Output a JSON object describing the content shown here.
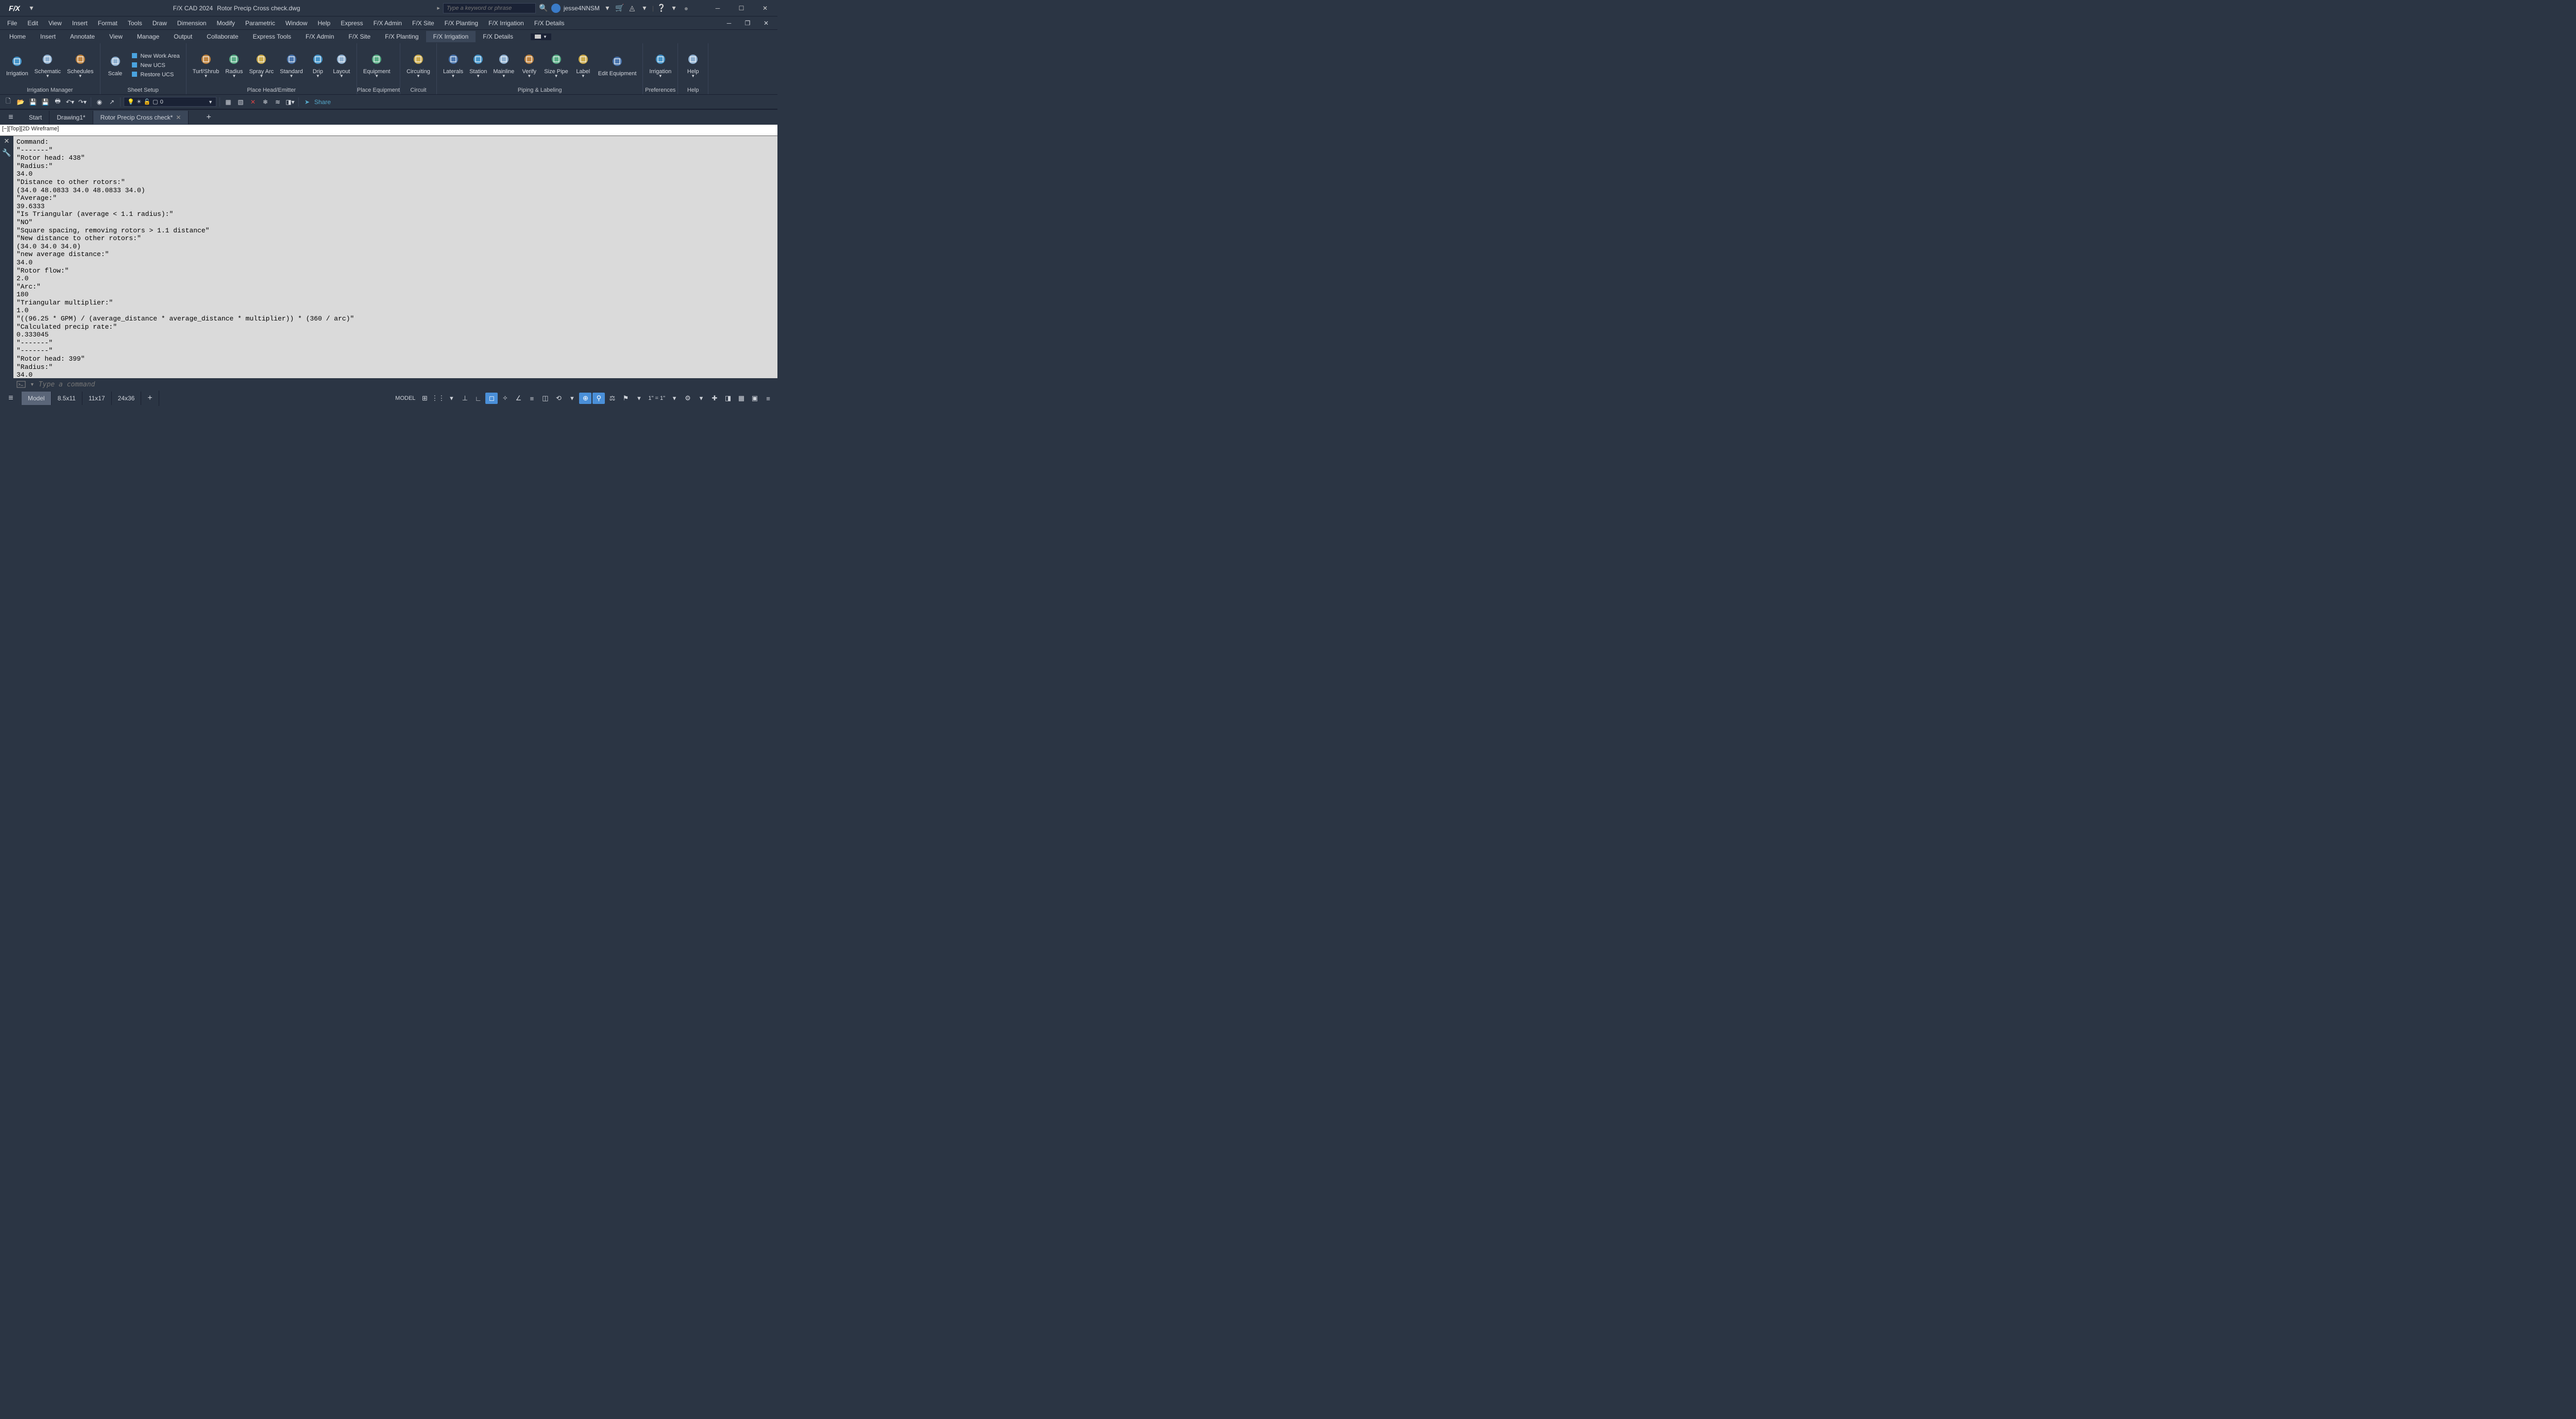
{
  "titlebar": {
    "logo": "F/X",
    "app": "F/X CAD 2024",
    "doc": "Rotor Precip Cross check.dwg",
    "search_placeholder": "Type a keyword or phrase",
    "username": "jesse4NNSM"
  },
  "menubar": [
    "File",
    "Edit",
    "View",
    "Insert",
    "Format",
    "Tools",
    "Draw",
    "Dimension",
    "Modify",
    "Parametric",
    "Window",
    "Help",
    "Express",
    "F/X Admin",
    "F/X Site",
    "F/X Planting",
    "F/X Irrigation",
    "F/X Details"
  ],
  "tabs": [
    "Home",
    "Insert",
    "Annotate",
    "View",
    "Manage",
    "Output",
    "Collaborate",
    "Express Tools",
    "F/X Admin",
    "F/X Site",
    "F/X Planting",
    "F/X Irrigation",
    "F/X Details"
  ],
  "active_tab": "F/X Irrigation",
  "ribbon": {
    "panels": [
      {
        "label": "Irrigation Manager",
        "items": [
          {
            "l": "Irrigation"
          },
          {
            "l": "Schematic",
            "dd": true
          },
          {
            "l": "Schedules",
            "dd": true
          }
        ]
      },
      {
        "label": "Sheet Setup",
        "items": [
          {
            "l": "Scale"
          }
        ],
        "col": [
          {
            "l": "New Work Area"
          },
          {
            "l": "New UCS"
          },
          {
            "l": "Restore UCS"
          }
        ]
      },
      {
        "label": "Place Head/Emitter",
        "items": [
          {
            "l": "Turf/Shrub",
            "dd": true
          },
          {
            "l": "Radius",
            "dd": true
          },
          {
            "l": "Spray Arc",
            "dd": true
          },
          {
            "l": "Standard",
            "dd": true
          },
          {
            "l": "Drip",
            "dd": true
          },
          {
            "l": "Layout",
            "dd": true
          }
        ]
      },
      {
        "label": "Place Equipment",
        "items": [
          {
            "l": "Equipment",
            "dd": true
          }
        ]
      },
      {
        "label": "Circuit",
        "items": [
          {
            "l": "Circuiting",
            "dd": true
          }
        ]
      },
      {
        "label": "Piping & Labeling",
        "items": [
          {
            "l": "Laterals",
            "dd": true
          },
          {
            "l": "Station",
            "dd": true
          },
          {
            "l": "Mainline",
            "dd": true
          },
          {
            "l": "Verify",
            "dd": true
          },
          {
            "l": "Size Pipe",
            "dd": true
          },
          {
            "l": "Label",
            "dd": true
          },
          {
            "l": "Edit\nEquipment"
          }
        ]
      },
      {
        "label": "Preferences",
        "items": [
          {
            "l": "Irrigation",
            "dd": true
          }
        ]
      },
      {
        "label": "Help",
        "items": [
          {
            "l": "Help",
            "dd": true
          }
        ]
      }
    ]
  },
  "layer": {
    "value": "0"
  },
  "share_label": "Share",
  "doctabs": [
    "Start",
    "Drawing1*",
    "Rotor Precip Cross check*"
  ],
  "active_doctab": "Rotor Precip Cross check*",
  "viewheader": "[−][Top][2D Wireframe]",
  "command_history": "Command:\n\"-------\"\n\"Rotor head: 438\"\n\"Radius:\"\n34.0\n\"Distance to other rotors:\"\n(34.0 48.0833 34.0 48.0833 34.0)\n\"Average:\"\n39.6333\n\"Is Triangular (average < 1.1 radius):\"\n\"NO\"\n\"Square spacing, removing rotors > 1.1 distance\"\n\"New distance to other rotors:\"\n(34.0 34.0 34.0)\n\"new average distance:\"\n34.0\n\"Rotor flow:\"\n2.0\n\"Arc:\"\n180\n\"Triangular multiplier:\"\n1.0\n\"((96.25 * GPM) / (average_distance * average_distance * multiplier)) * (360 / arc)\"\n\"Calculated precip rate:\"\n0.333045\n\"-------\"\n\"-------\"\n\"Rotor head: 399\"\n\"Radius:\"\n34.0",
  "command_placeholder": "Type a command",
  "layouts": [
    "Model",
    "8.5x11",
    "11x17",
    "24x36"
  ],
  "active_layout": "Model",
  "status_chips": {
    "model": "MODEL",
    "scale": "1\" = 1\""
  }
}
